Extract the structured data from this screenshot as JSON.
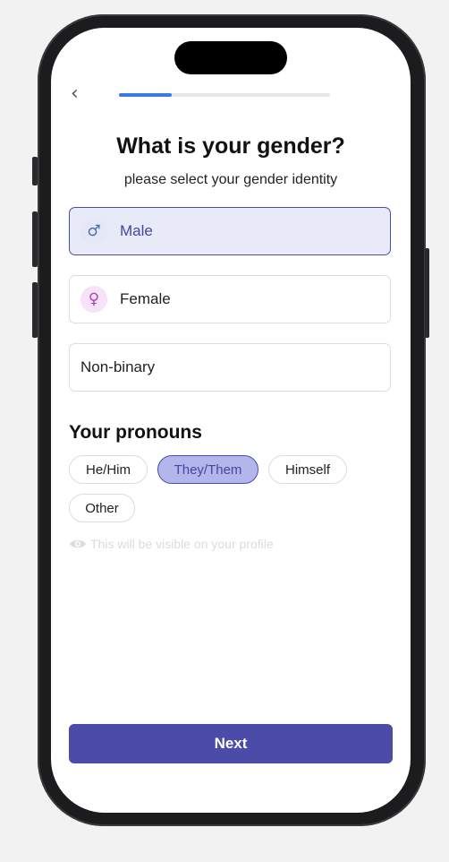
{
  "progress": {
    "fraction": 0.25
  },
  "header": {
    "back_icon": "chevron-left-icon",
    "back_glyph": "‹"
  },
  "title": "What is your gender?",
  "subtitle": "please select your gender identity",
  "genders": [
    {
      "label": "Male",
      "icon": "male-symbol-icon",
      "glyph": "♂",
      "selected": true
    },
    {
      "label": "Female",
      "icon": "female-symbol-icon",
      "glyph": "♀",
      "selected": false
    },
    {
      "label": "Non-binary",
      "icon": null,
      "selected": false
    }
  ],
  "pronouns": {
    "title": "Your pronouns",
    "options": [
      {
        "label": "He/Him",
        "selected": false
      },
      {
        "label": "They/Them",
        "selected": true
      },
      {
        "label": "Himself",
        "selected": false
      },
      {
        "label": "Other",
        "selected": false
      }
    ],
    "hint": "This will be visible on your profile",
    "hint_icon": "eye-icon"
  },
  "next_label": "Next",
  "colors": {
    "accent": "#4a4ca8",
    "progress": "#3b79e5",
    "selected_bg": "#e8eaf8",
    "pill_selected_bg": "#b3b6ea",
    "male_icon_bg": "#e3e8f4",
    "male_icon_fg": "#4a6fa8",
    "female_icon_bg": "#f6e3f7",
    "female_icon_fg": "#b43fc0"
  }
}
